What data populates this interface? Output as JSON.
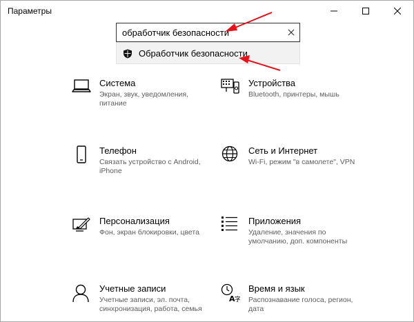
{
  "window": {
    "title": "Параметры"
  },
  "search": {
    "value": "обработчик безопасности"
  },
  "suggestion": {
    "label": "Обработчик безопасности"
  },
  "tiles": [
    {
      "title": "Система",
      "desc": "Экран, звук, уведомления, питание",
      "icon": "laptop-icon"
    },
    {
      "title": "Устройства",
      "desc": "Bluetooth, принтеры, мышь",
      "icon": "devices-icon"
    },
    {
      "title": "Телефон",
      "desc": "Связать устройство с Android, iPhone",
      "icon": "phone-icon"
    },
    {
      "title": "Сеть и Интернет",
      "desc": "Wi-Fi, режим \"в самолете\", VPN",
      "icon": "globe-icon"
    },
    {
      "title": "Персонализация",
      "desc": "Фон, экран блокировки, цвета",
      "icon": "personalization-icon"
    },
    {
      "title": "Приложения",
      "desc": "Удаление, значения по умолчанию, доп. компоненты",
      "icon": "apps-icon"
    },
    {
      "title": "Учетные записи",
      "desc": "Учетные записи, эл. почта, синхронизация, работа, семья",
      "icon": "person-icon"
    },
    {
      "title": "Время и язык",
      "desc": "Распознавание голоса, регион, дата",
      "icon": "time-language-icon"
    }
  ],
  "colors": {
    "arrow": "#e8101a",
    "accent": "#000000"
  }
}
